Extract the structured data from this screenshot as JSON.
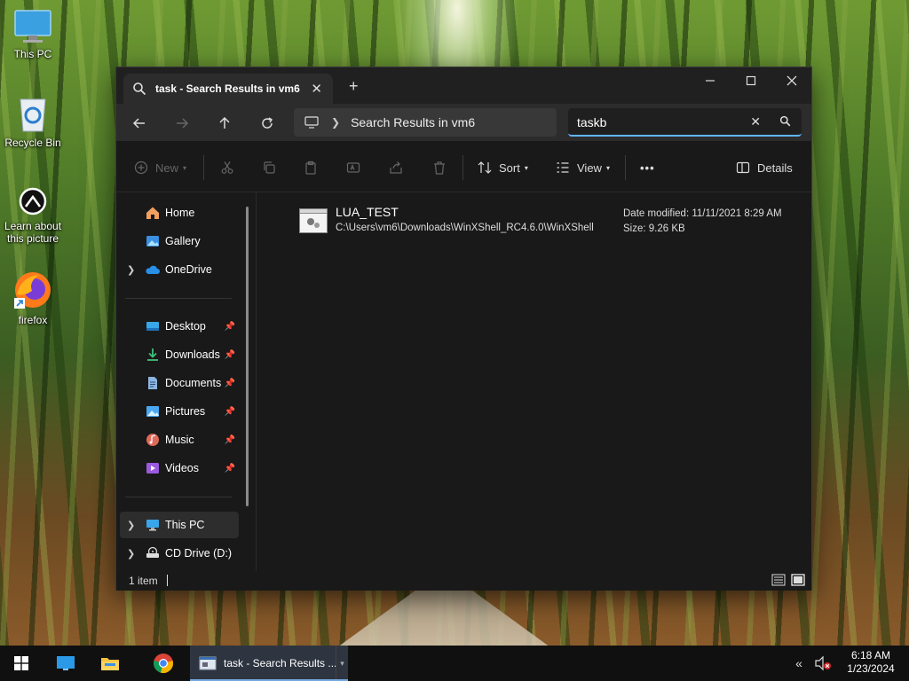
{
  "desktop": {
    "icons": [
      {
        "label": "This PC"
      },
      {
        "label": "Recycle Bin"
      },
      {
        "label": "Learn about this picture"
      },
      {
        "label": "firefox"
      }
    ]
  },
  "window": {
    "tab_title": "task - Search Results in vm6",
    "new_tab_label": "+",
    "address": {
      "location": "Search Results in vm6"
    },
    "search": {
      "value": "taskb"
    },
    "toolbar": {
      "new_label": "New",
      "sort_label": "Sort",
      "view_label": "View",
      "more_label": "•••",
      "details_label": "Details"
    },
    "nav": {
      "home": "Home",
      "gallery": "Gallery",
      "onedrive": "OneDrive",
      "desktop": "Desktop",
      "downloads": "Downloads",
      "documents": "Documents",
      "pictures": "Pictures",
      "music": "Music",
      "videos": "Videos",
      "this_pc": "This PC",
      "cd_drive": "CD Drive (D:)"
    },
    "results": [
      {
        "name": "LUA_TEST",
        "path": "C:\\Users\\vm6\\Downloads\\WinXShell_RC4.6.0\\WinXShell",
        "date_modified": "Date modified: 11/11/2021 8:29 AM",
        "size": "Size: 9.26 KB"
      }
    ],
    "status": {
      "item_count": "1 item"
    }
  },
  "taskbar": {
    "active_window_label": "task - Search Results ...",
    "time": "6:18 AM",
    "date": "1/23/2024"
  },
  "colors": {
    "accent": "#60b5ff",
    "window_bg": "#191919",
    "titlebar_bg": "#202020",
    "taskbar_bg": "#101010"
  }
}
